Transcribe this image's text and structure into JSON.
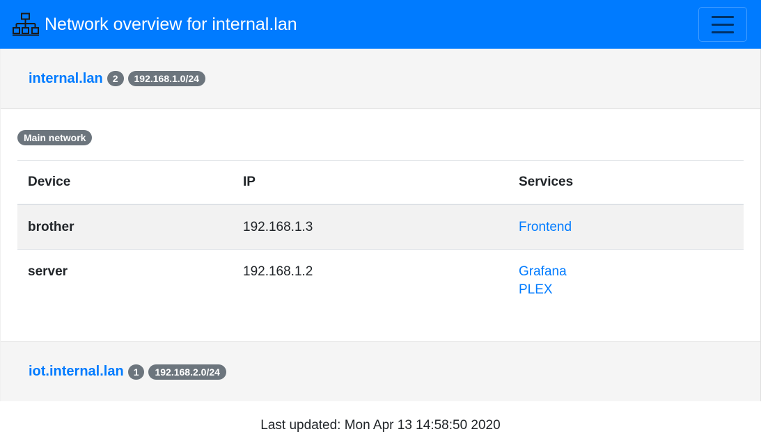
{
  "navbar": {
    "title": "Network overview for internal.lan",
    "icon": "network-icon",
    "toggler_icon": "hamburger-menu-icon",
    "background": "#007bff"
  },
  "networks": [
    {
      "name": "internal.lan",
      "count": "2",
      "subnet": "192.168.1.0/24",
      "description": "Main network",
      "table": {
        "headers": [
          "Device",
          "IP",
          "Services"
        ],
        "rows": [
          {
            "device": "brother",
            "ip": "192.168.1.3",
            "services": [
              "Frontend"
            ]
          },
          {
            "device": "server",
            "ip": "192.168.1.2",
            "services": [
              "Grafana",
              "PLEX"
            ]
          }
        ]
      }
    },
    {
      "name": "iot.internal.lan",
      "count": "1",
      "subnet": "192.168.2.0/24"
    }
  ],
  "footer": {
    "last_updated": "Last updated: Mon Apr 13 14:58:50 2020"
  },
  "colors": {
    "link": "#007bff",
    "badge": "#6c757d",
    "header_bg": "#f5f5f5"
  }
}
